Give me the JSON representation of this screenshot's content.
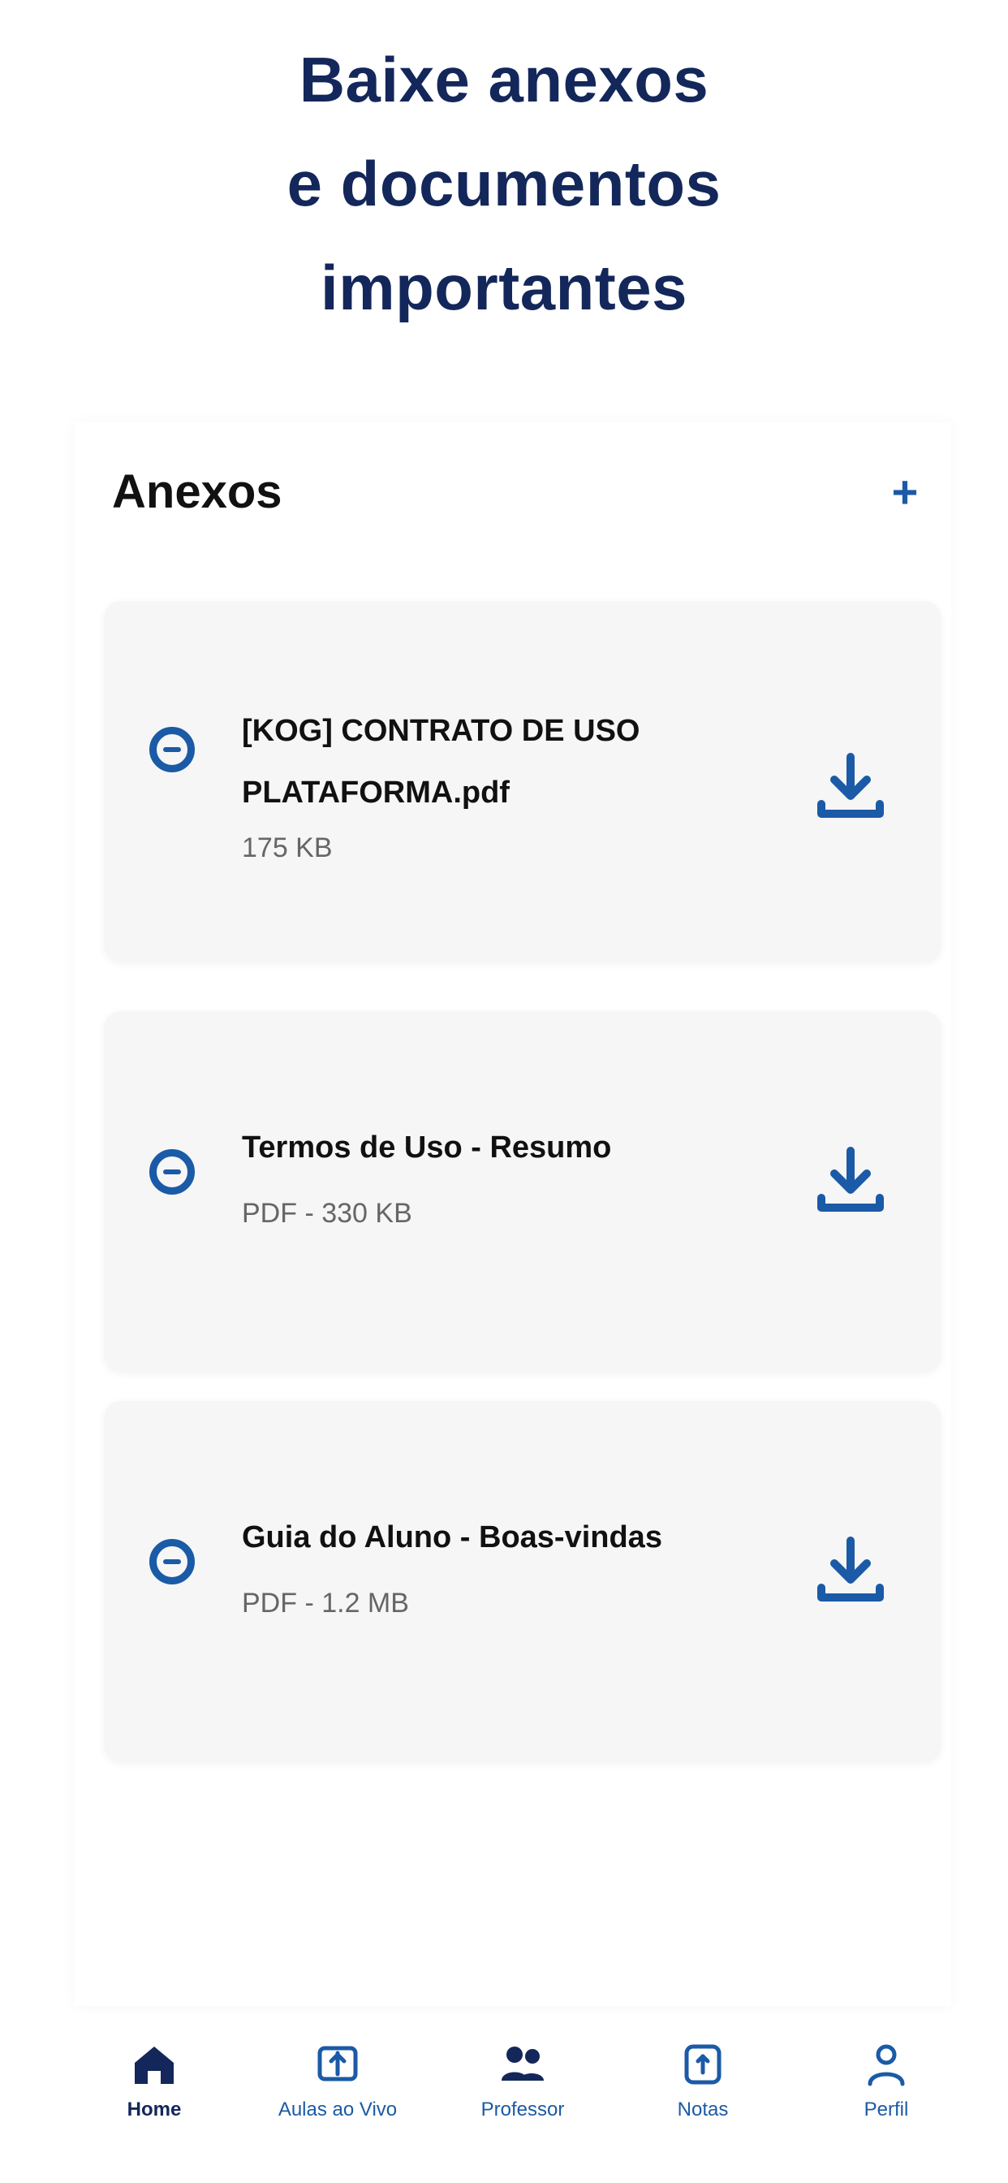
{
  "hero": {
    "line1": "Baixe anexos",
    "line2": "e documentos",
    "line3": "importantes"
  },
  "section": {
    "title": "Anexos",
    "add_label": "+"
  },
  "attachments": [
    {
      "name": "[KOG] CONTRATO DE USO PLATAFORMA.pdf",
      "meta": "175 KB",
      "icon": "document-icon",
      "download_icon": "download-icon"
    },
    {
      "name": "Termos de Uso - Resumo",
      "meta": "PDF - 330 KB",
      "icon": "document-icon",
      "download_icon": "download-icon"
    },
    {
      "name": "Guia do Aluno - Boas-vindas",
      "meta": "PDF - 1.2 MB",
      "icon": "document-icon",
      "download_icon": "download-icon"
    }
  ],
  "nav": {
    "items": [
      {
        "label": "Home",
        "icon": "home-icon",
        "active": true
      },
      {
        "label": "Aulas ao Vivo",
        "icon": "live-class-icon",
        "active": false
      },
      {
        "label": "Professor",
        "icon": "teacher-icon",
        "active": false
      },
      {
        "label": "Notas",
        "icon": "notes-icon",
        "active": false
      },
      {
        "label": "Perfil",
        "icon": "profile-icon",
        "active": false
      }
    ]
  },
  "colors": {
    "primary": "#1b5aa6",
    "hero": "#13275a",
    "card": "#f6f6f6"
  }
}
